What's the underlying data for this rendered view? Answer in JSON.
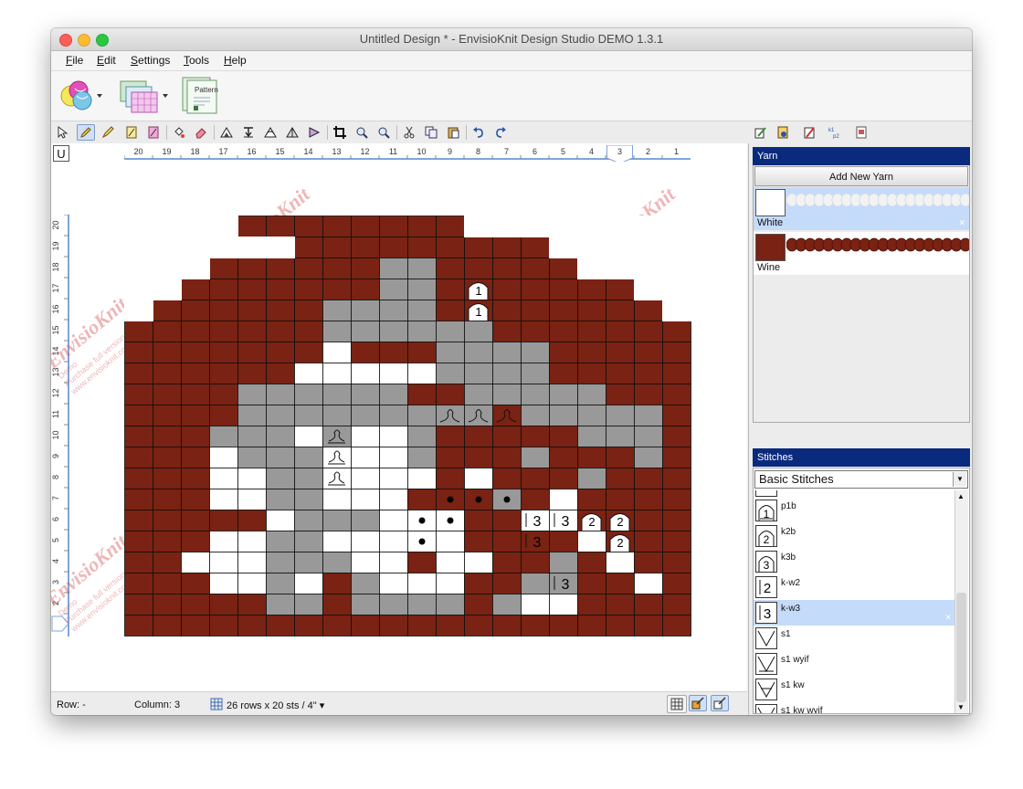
{
  "window": {
    "title": "Untitled Design * - EnvisioKnit Design Studio DEMO 1.3.1"
  },
  "menu": [
    {
      "key": "F",
      "rest": "ile"
    },
    {
      "key": "E",
      "rest": "dit"
    },
    {
      "key": "S",
      "rest": "ettings"
    },
    {
      "key": "T",
      "rest": "ools"
    },
    {
      "key": "H",
      "rest": "elp"
    }
  ],
  "big_toolbar": {
    "pattern_label": "Pattern"
  },
  "ruler": {
    "columns": [
      "20",
      "19",
      "18",
      "17",
      "16",
      "15",
      "14",
      "13",
      "12",
      "11",
      "10",
      "9",
      "8",
      "7",
      "6",
      "5",
      "4",
      "3",
      "2",
      "1"
    ],
    "rows": [
      "20",
      "19",
      "18",
      "17",
      "16",
      "15",
      "14",
      "13",
      "12",
      "11",
      "10",
      "9",
      "8",
      "7",
      "6",
      "5",
      "4",
      "3",
      "2",
      "1"
    ],
    "highlighted_column": "3"
  },
  "canvas": {
    "u_button": "U"
  },
  "watermark": {
    "brand": "EnvisioKnit",
    "demo": "Demo",
    "line1": "Purchase full version at",
    "line2": "www.envisioknit.com"
  },
  "colors": {
    "wine": "#7a2213",
    "white": "#ffffff",
    "gray": "#999999",
    "header": "#0a2a7d",
    "selected": "#c5dbfa"
  },
  "chart": {
    "rows": [
      "....WWWWWWWW........",
      "......WWWWWWWWW.....",
      "...WWWWWWGGWWWWW....",
      "..WWWWWWWGGWWWWWWW..",
      ".WWWWWWGGGGWWWWWWWW.",
      "WWWWWWWGGGGGGWWWWWWW",
      "WWWWWWW.WWWGGGGWWWWW",
      "WWWWWW.....GGGGWWWWW",
      "WWWWGGGGGGWWGGGGGWWW",
      "WWWWGGGGGGGGGWGGGGGW",
      "WWWGGG.G..GWWWWWGGGW",
      "WWW.GGG...GWWWGWWWGW",
      "WWW..GG....W.WWWGWWW",
      "WWW..GG...WWWGW.WWWW",
      "WWWWW.GGG...WW..WWWW",
      "WWW..GG.....WWWW.WWW",
      "WW...GGG..W..WWGW.WW",
      "WWW..G.WG...WWGGWW.W",
      "WWWWWGGWGGGGWG..WWWW",
      "WWWWWWWWWWWWWWWWWWWW"
    ],
    "symbols": [
      {
        "r": 3,
        "c": 12,
        "sym": "1b"
      },
      {
        "r": 4,
        "c": 12,
        "sym": "1b"
      },
      {
        "r": 9,
        "c": 11,
        "sym": "loop"
      },
      {
        "r": 9,
        "c": 12,
        "sym": "loop"
      },
      {
        "r": 9,
        "c": 13,
        "sym": "loop"
      },
      {
        "r": 10,
        "c": 7,
        "sym": "loopbar"
      },
      {
        "r": 11,
        "c": 7,
        "sym": "loopbar"
      },
      {
        "r": 12,
        "c": 7,
        "sym": "loopbar"
      },
      {
        "r": 13,
        "c": 11,
        "sym": "dot"
      },
      {
        "r": 13,
        "c": 12,
        "sym": "dot"
      },
      {
        "r": 13,
        "c": 13,
        "sym": "dot"
      },
      {
        "r": 14,
        "c": 10,
        "sym": "dot"
      },
      {
        "r": 14,
        "c": 11,
        "sym": "dot"
      },
      {
        "r": 14,
        "c": 14,
        "sym": "3"
      },
      {
        "r": 14,
        "c": 15,
        "sym": "3"
      },
      {
        "r": 14,
        "c": 16,
        "sym": "2b"
      },
      {
        "r": 14,
        "c": 17,
        "sym": "2b"
      },
      {
        "r": 15,
        "c": 10,
        "sym": "dot"
      },
      {
        "r": 15,
        "c": 14,
        "sym": "3"
      },
      {
        "r": 15,
        "c": 17,
        "sym": "2b"
      },
      {
        "r": 17,
        "c": 15,
        "sym": "3"
      }
    ]
  },
  "statusbar": {
    "row": "Row: -",
    "column": "Column: 3",
    "size": "26 rows x 20 sts / 4\""
  },
  "yarn_panel": {
    "header": "Yarn",
    "add_button": "Add New Yarn",
    "yarns": [
      {
        "name": "White",
        "color": "#ffffff",
        "selected": true
      },
      {
        "name": "Wine",
        "color": "#7a2213",
        "selected": false
      }
    ]
  },
  "stitch_panel": {
    "header": "Stitches",
    "library": "Basic Stitches",
    "stitches": [
      {
        "label": "p1b",
        "icon": "purl-1-below-icon"
      },
      {
        "label": "k2b",
        "icon": "knit-2-below-icon"
      },
      {
        "label": "k3b",
        "icon": "knit-3-below-icon"
      },
      {
        "label": "k-w2",
        "icon": "knit-wrap-2-icon"
      },
      {
        "label": "k-w3",
        "icon": "knit-wrap-3-icon",
        "selected": true
      },
      {
        "label": "s1",
        "icon": "slip-1-icon"
      },
      {
        "label": "s1 wyif",
        "icon": "slip-1-wyif-icon"
      },
      {
        "label": "s1 kw",
        "icon": "slip-1-kw-icon"
      },
      {
        "label": "s1 kw wyif",
        "icon": "slip-1-kw-wyif-icon"
      }
    ]
  }
}
